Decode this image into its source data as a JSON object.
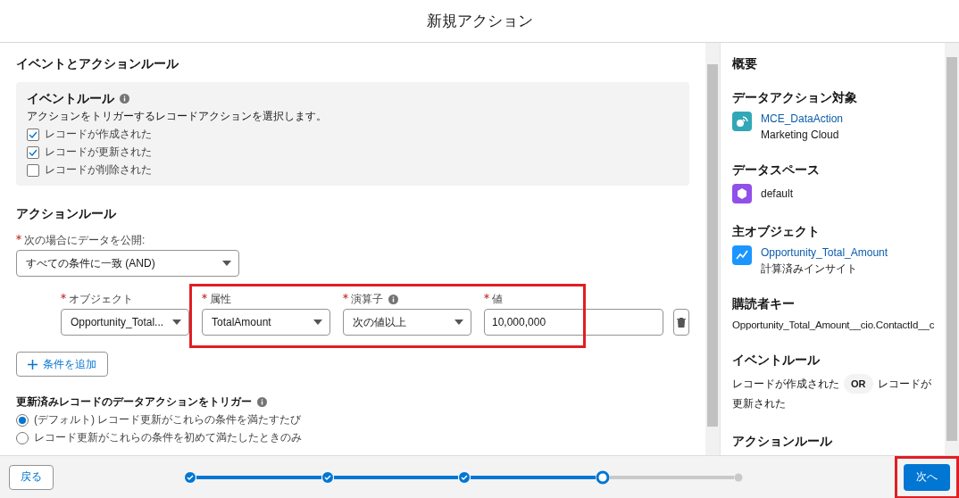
{
  "title": "新規アクション",
  "main": {
    "heading": "イベントとアクションルール",
    "event_rule": {
      "title": "イベントルール",
      "has_info": true,
      "description": "アクションをトリガーするレコードアクションを選択します。",
      "options": [
        {
          "label": "レコードが作成された",
          "checked": true
        },
        {
          "label": "レコードが更新された",
          "checked": true
        },
        {
          "label": "レコードが削除された",
          "checked": false
        }
      ]
    },
    "action_rule": {
      "heading": "アクションルール",
      "match_label": "次の場合にデータを公開:",
      "match_required": true,
      "match_value": "すべての条件に一致 (AND)",
      "condition_fields": [
        {
          "label": "オブジェクト",
          "value": "Opportunity_Total...",
          "kind": "select",
          "required": true,
          "has_info": false,
          "highlighted": false
        },
        {
          "label": "属性",
          "value": "TotalAmount",
          "kind": "select",
          "required": true,
          "has_info": false,
          "highlighted": true
        },
        {
          "label": "演算子",
          "value": "次の値以上",
          "kind": "select",
          "required": true,
          "has_info": true,
          "highlighted": true
        },
        {
          "label": "値",
          "value": "10,000,000",
          "kind": "input",
          "required": true,
          "has_info": false,
          "highlighted": true
        }
      ],
      "add_button": "条件を追加",
      "trigger": {
        "label": "更新済みレコードのデータアクションをトリガー",
        "has_info": true,
        "options": [
          {
            "label": "(デフォルト) レコード更新がこれらの条件を満たすたび",
            "selected": true
          },
          {
            "label": "レコード更新がこれらの条件を初めて満たしたときのみ",
            "selected": false
          }
        ]
      }
    }
  },
  "summary": {
    "heading": "概要",
    "sections": [
      {
        "kind": "item",
        "title": "データアクション対象",
        "link": "MCE_DataAction",
        "subtitle": "Marketing Cloud",
        "color": "#31a7b8"
      },
      {
        "kind": "item",
        "title": "データスペース",
        "subtitle": "default",
        "color": "#9050e9"
      },
      {
        "kind": "item",
        "title": "主オブジェクト",
        "link": "Opportunity_Total_Amount",
        "subtitle": "計算済みインサイト",
        "color": "#1b96ff"
      },
      {
        "kind": "text",
        "title": "購読者キー",
        "text": "Opportunity_Total_Amount__cio.ContactId__c"
      },
      {
        "kind": "event",
        "title": "イベントルール",
        "first": "レコードが作成された",
        "operator": "OR",
        "second": "レコードが",
        "rest": "更新された"
      },
      {
        "kind": "heading",
        "title": "アクションルール"
      }
    ]
  },
  "footer": {
    "back": "戻る",
    "next": "次へ",
    "next_highlighted": true,
    "steps": [
      {
        "done": true,
        "current": false
      },
      {
        "done": true,
        "current": false
      },
      {
        "done": true,
        "current": false
      },
      {
        "done": false,
        "current": true
      },
      {
        "done": false,
        "current": false
      }
    ]
  }
}
